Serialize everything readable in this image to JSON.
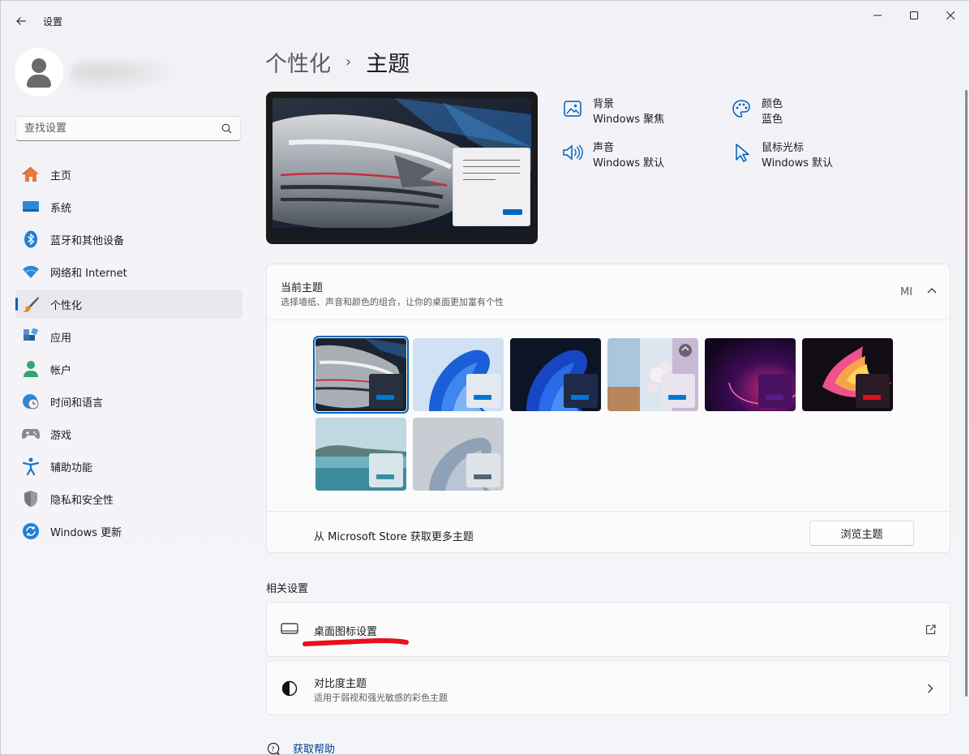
{
  "window": {
    "title": "设置",
    "controls": {
      "minimize": "—",
      "maximize": "▢",
      "close": "✕"
    }
  },
  "search": {
    "placeholder": "查找设置"
  },
  "sidebar": {
    "items": [
      {
        "label": "主页",
        "icon": "home-icon",
        "color": "#e5763a"
      },
      {
        "label": "系统",
        "icon": "system-icon",
        "color": "#2b88d8"
      },
      {
        "label": "蓝牙和其他设备",
        "icon": "bluetooth-icon",
        "color": "#1f7fd9"
      },
      {
        "label": "网络和 Internet",
        "icon": "wifi-icon",
        "color": "#2a8bd8"
      },
      {
        "label": "个性化",
        "icon": "brush-icon",
        "color": "#e08a3c",
        "active": true
      },
      {
        "label": "应用",
        "icon": "apps-icon",
        "color": "#3a6ea5"
      },
      {
        "label": "帐户",
        "icon": "account-icon",
        "color": "#2fa76e"
      },
      {
        "label": "时间和语言",
        "icon": "clock-globe-icon",
        "color": "#2b88d8"
      },
      {
        "label": "游戏",
        "icon": "gamepad-icon",
        "color": "#6b6b6b"
      },
      {
        "label": "辅助功能",
        "icon": "accessibility-icon",
        "color": "#1a73c8"
      },
      {
        "label": "隐私和安全性",
        "icon": "shield-icon",
        "color": "#6f6f6f"
      },
      {
        "label": "Windows 更新",
        "icon": "update-icon",
        "color": "#1f80d6"
      }
    ]
  },
  "header": {
    "parent": "个性化",
    "separator": "›",
    "current": "主题"
  },
  "properties": {
    "background": {
      "label": "背景",
      "value": "Windows 聚焦"
    },
    "color": {
      "label": "颜色",
      "value": "蓝色"
    },
    "sound": {
      "label": "声音",
      "value": "Windows 默认"
    },
    "cursor": {
      "label": "鼠标光标",
      "value": "Windows 默认"
    }
  },
  "theme_section": {
    "title": "当前主题",
    "description": "选择墙纸、声音和颜色的组合，让你的桌面更加富有个性",
    "current_theme": "MI",
    "themes": [
      {
        "name": "windows-spotlight-car",
        "selected": true,
        "accent": "#0078d4"
      },
      {
        "name": "windows-light-bloom",
        "accent": "#0078d4"
      },
      {
        "name": "windows-dark-bloom",
        "accent": "#0078d4"
      },
      {
        "name": "spotlight-collection",
        "accent": "#0078d4"
      },
      {
        "name": "glow-purple",
        "accent": "#4b0f7a"
      },
      {
        "name": "captured-motion",
        "accent": "#d9121c"
      },
      {
        "name": "sunrise-lake",
        "accent": "#3a8ea1"
      },
      {
        "name": "flow-grey",
        "accent": "#556673"
      }
    ],
    "store_text": "从 Microsoft Store 获取更多主题",
    "browse_button": "浏览主题"
  },
  "related": {
    "title": "相关设置",
    "items": [
      {
        "title": "桌面图标设置",
        "trail": "open-external-icon"
      },
      {
        "title": "对比度主题",
        "description": "适用于弱视和强光敏感的彩色主题",
        "trail": "chevron-right-icon"
      }
    ]
  },
  "help": {
    "label": "获取帮助"
  },
  "colors": {
    "accent": "#005fb8",
    "annotation": "#e8101c"
  }
}
